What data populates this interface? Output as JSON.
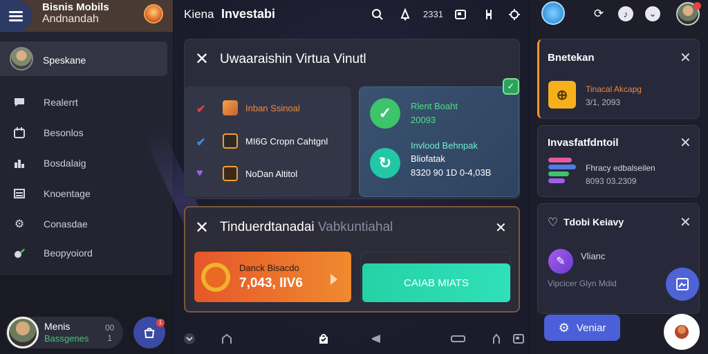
{
  "sidebar": {
    "brand_line1": "Bisnis Mobils",
    "brand_line2": "Andnandah",
    "profile_name": "Speskane",
    "items": [
      {
        "label": "Realerrt",
        "icon": "chat-icon"
      },
      {
        "label": "Besonlos",
        "icon": "calendar-icon"
      },
      {
        "label": "Bosdalaig",
        "icon": "chart-icon"
      },
      {
        "label": "Knoentage",
        "icon": "list-icon"
      },
      {
        "label": "Conasdae",
        "icon": "gear-icon"
      },
      {
        "label": "Beopyoiord",
        "icon": "leaf-icon"
      }
    ],
    "user_name": "Menis",
    "user_sub": "Bassgenes",
    "user_mini_top": "00",
    "user_mini_bottom": "1",
    "bag_badge": "1"
  },
  "topbar": {
    "title1": "Kiena",
    "title2": "Investabi",
    "count": "2331"
  },
  "main_card": {
    "title": "Uwaaraishin Virtua Vinutl",
    "list": [
      {
        "text": "Inban Ssinoal",
        "check_color": "#e0453f",
        "text_color": "#f08a3e"
      },
      {
        "text": "MI6G Cropn Cahtgnl",
        "check_color": "#3b8ee0",
        "text_color": "#ffffff"
      },
      {
        "text": "NoDan Altitol",
        "check_color": "#a35dea",
        "text_color": "#ffffff"
      }
    ],
    "stat1_line1": "Rlent Boaht",
    "stat1_line2": "20093",
    "stat2_line1": "Invlood Behnpak",
    "stat2_line2": "Bliofatak",
    "stat2_line3": "8320 90 1D 0-4,03B",
    "badge": "✓"
  },
  "second_card": {
    "title_main": "Tinduerdtanadai",
    "title_dim": "Vabkuntiahal",
    "orange_label": "Danck Bisacdo",
    "orange_value": "7,043, IIV6",
    "teal_label": "CAIAB MIATS"
  },
  "right": {
    "card1": {
      "title": "Bnetekan",
      "line1": "Tinacal Akcapg",
      "line2": "3/1, 2093"
    },
    "card2": {
      "title": "Invasfatfdntoil",
      "line1": "Fhracy edbalseilen",
      "line2": "8093 03.2309"
    },
    "card3": {
      "title": "Tdobi Keiavy",
      "line1": "Vlianc",
      "line2": "Vipcicer Glyn Mdid"
    },
    "veniar_label": "Veniar"
  },
  "colors": {
    "accent_orange": "#f08a2e",
    "accent_teal": "#25d2a6",
    "accent_blue": "#4e63d6",
    "accent_green": "#48c27a"
  }
}
